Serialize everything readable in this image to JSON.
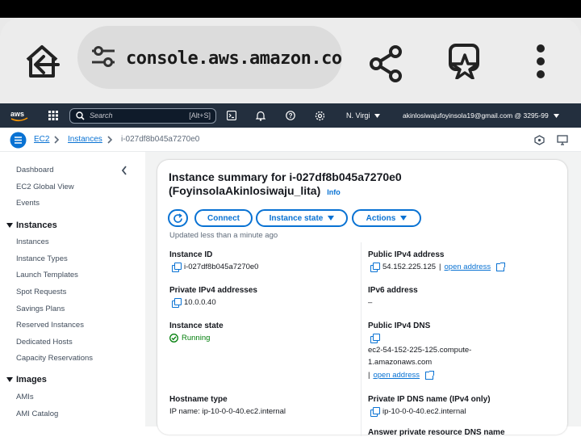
{
  "browser": {
    "url": "console.aws.amazon.com"
  },
  "nav": {
    "search_placeholder": "Search",
    "search_shortcut": "[Alt+S]",
    "region": "N. Virgi",
    "account": "akinlosiwajufoyinsola19@gmail.com @ 3295-99"
  },
  "breadcrumb": {
    "service": "EC2",
    "section": "Instances",
    "current": "i-027df8b045a7270e0"
  },
  "sidebar": {
    "top_links": [
      "Dashboard",
      "EC2 Global View",
      "Events"
    ],
    "instances_header": "Instances",
    "instances_links": [
      "Instances",
      "Instance Types",
      "Launch Templates",
      "Spot Requests",
      "Savings Plans",
      "Reserved Instances",
      "Dedicated Hosts",
      "Capacity Reservations"
    ],
    "images_header": "Images",
    "images_links": [
      "AMIs",
      "AMI Catalog"
    ]
  },
  "summary": {
    "title_line1": "Instance summary for i-027df8b045a7270e0",
    "title_line2": "(FoyinsolaAkinlosiwaju_lita)",
    "info": "Info",
    "connect": "Connect",
    "instance_state_btn": "Instance state",
    "actions_btn": "Actions",
    "updated": "Updated less than a minute ago"
  },
  "details": {
    "instance_id_label": "Instance ID",
    "instance_id": "i-027df8b045a7270e0",
    "private_ipv4_label": "Private IPv4 addresses",
    "private_ipv4": "10.0.0.40",
    "instance_state_label": "Instance state",
    "instance_state": "Running",
    "hostname_type_label": "Hostname type",
    "hostname_type": "IP name: ip-10-0-0-40.ec2.internal",
    "public_ipv4_label": "Public IPv4 address",
    "public_ipv4": "54.152.225.125",
    "open_address": "open address",
    "ipv6_label": "IPv6 address",
    "ipv6": "–",
    "public_dns_label": "Public IPv4 DNS",
    "public_dns_line1": "ec2-54-152-225-125.compute-",
    "public_dns_line2": "1.amazonaws.com",
    "private_dns_label": "Private IP DNS name (IPv4 only)",
    "private_dns": "ip-10-0-0-40.ec2.internal",
    "answer_label": "Answer private resource DNS name"
  },
  "colors": {
    "accent": "#0972d3",
    "nav_bg": "#232f3e",
    "success": "#037f0c"
  }
}
